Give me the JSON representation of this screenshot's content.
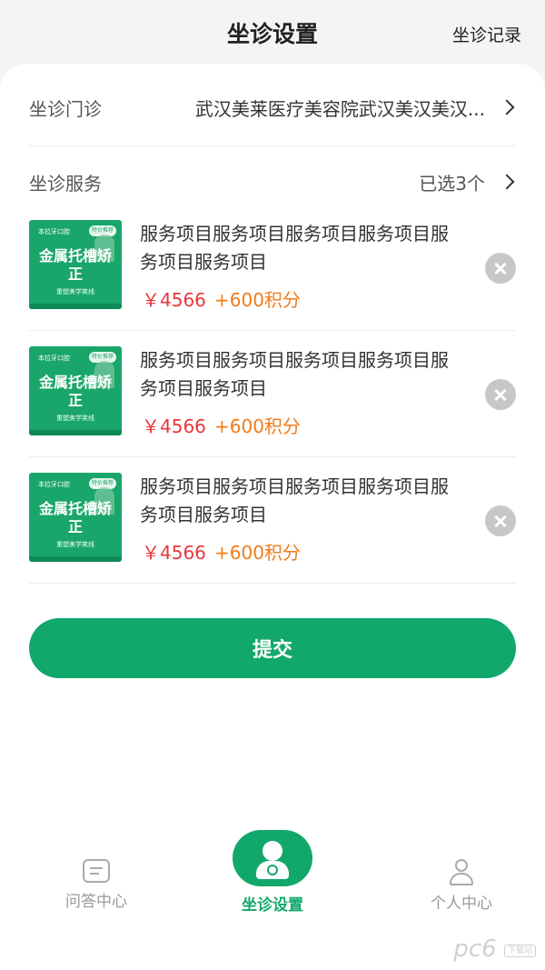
{
  "header": {
    "title": "坐诊设置",
    "record_link": "坐诊记录"
  },
  "clinic": {
    "label": "坐诊门诊",
    "value": "武汉美莱医疗美容院武汉美汉美汉..."
  },
  "services": {
    "label": "坐诊服务",
    "selected": "已选3个",
    "items": [
      {
        "name": "服务项目服务项目服务项目服务项目服务项目服务项目",
        "price": "￥4566",
        "points": "+600积分",
        "thumb": {
          "brand": "本拉牙口腔",
          "tag": "特价推荐",
          "text": "金属托槽矫正",
          "sub": "重塑美学笑线"
        }
      },
      {
        "name": "服务项目服务项目服务项目服务项目服务项目服务项目",
        "price": "￥4566",
        "points": "+600积分",
        "thumb": {
          "brand": "本拉牙口腔",
          "tag": "特价推荐",
          "text": "金属托槽矫正",
          "sub": "重塑美学笑线"
        }
      },
      {
        "name": "服务项目服务项目服务项目服务项目服务项目服务项目",
        "price": "￥4566",
        "points": "+600积分",
        "thumb": {
          "brand": "本拉牙口腔",
          "tag": "特价推荐",
          "text": "金属托槽矫正",
          "sub": "重塑美学笑线"
        }
      }
    ]
  },
  "submit_label": "提交",
  "tabbar": {
    "qa": "问答中心",
    "settings": "坐诊设置",
    "me": "个人中心"
  },
  "watermark": {
    "text": "pc6",
    "badge": "下载站"
  },
  "colors": {
    "accent": "#12a86b",
    "price": "#e8383c",
    "points": "#f07b1a"
  }
}
